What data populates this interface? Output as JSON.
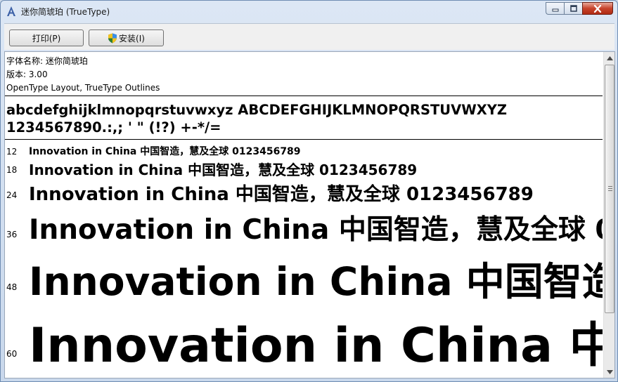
{
  "window": {
    "title": "迷你简琥珀 (TrueType)"
  },
  "toolbar": {
    "print_label": "打印(P)",
    "install_label": "安装(I)"
  },
  "font_info": {
    "name_line": "字体名称: 迷你简琥珀",
    "version_line": "版本: 3.00",
    "outline_line": "OpenType Layout, TrueType Outlines"
  },
  "charset": {
    "line1": "abcdefghijklmnopqrstuvwxyz ABCDEFGHIJKLMNOPQRSTUVWXYZ",
    "line2": "1234567890.:,; ' \" (!?) +-*/="
  },
  "sample_sentence": "Innovation in China 中国智造，慧及全球 0123456789",
  "samples": [
    {
      "size": "12"
    },
    {
      "size": "18"
    },
    {
      "size": "24"
    },
    {
      "size": "36"
    },
    {
      "size": "48"
    },
    {
      "size": "60"
    }
  ],
  "icons": {
    "app": "font-a-icon",
    "shield": "uac-shield-icon",
    "minimize": "minimize-icon",
    "maximize": "maximize-icon",
    "close": "close-icon"
  },
  "colors": {
    "close_button": "#c7432b",
    "window_frame": "#cfdbea"
  }
}
